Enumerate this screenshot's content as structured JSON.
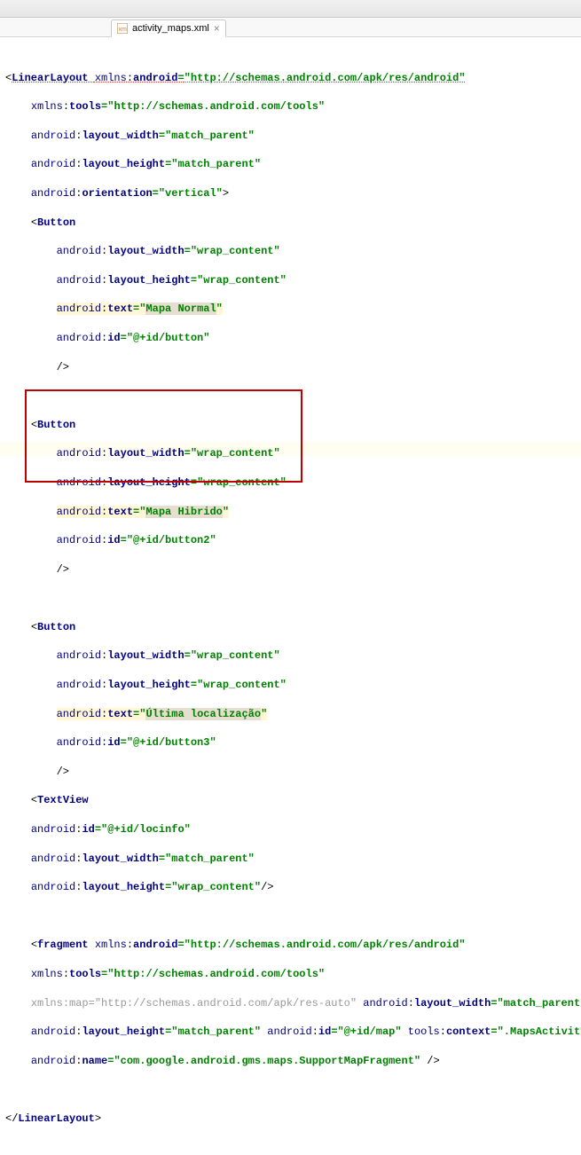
{
  "tab": {
    "filename": "activity_maps.xml",
    "icon": "xml-file-icon"
  },
  "code": {
    "l01a": "<",
    "l01b": "LinearLayout",
    "l01c": " ",
    "l01d": "xmlns",
    "l01e": ":",
    "l01f": "android",
    "l01g": "=",
    "l01h": "\"http://schemas.android.com/apk/res/android\"",
    "l02a": "xmlns",
    "l02b": ":",
    "l02c": "tools",
    "l02d": "=",
    "l02e": "\"http://schemas.android.com/tools\"",
    "l03a": "android",
    "l03b": ":",
    "l03c": "layout_width",
    "l03d": "=",
    "l03e": "\"match_parent\"",
    "l04a": "android",
    "l04b": ":",
    "l04c": "layout_height",
    "l04d": "=",
    "l04e": "\"match_parent\"",
    "l05a": "android",
    "l05b": ":",
    "l05c": "orientation",
    "l05d": "=",
    "l05e": "\"vertical\"",
    "l05f": ">",
    "l06a": "<",
    "l06b": "Button",
    "l07a": "android",
    "l07b": ":",
    "l07c": "layout_width",
    "l07d": "=",
    "l07e": "\"wrap_content\"",
    "l08a": "android",
    "l08b": ":",
    "l08c": "layout_height",
    "l08d": "=",
    "l08e": "\"wrap_content\"",
    "l09a": "android",
    "l09b": ":",
    "l09c": "text",
    "l09d": "=",
    "l09e": "\"",
    "l09f": "Mapa Normal",
    "l09g": "\"",
    "l10a": "android",
    "l10b": ":",
    "l10c": "id",
    "l10d": "=",
    "l10e": "\"@+id/button\"",
    "l11": "/>",
    "l13a": "<",
    "l13b": "Button",
    "l14a": "android",
    "l14b": ":",
    "l14c": "layout_width",
    "l14d": "=",
    "l14e": "\"wrap_content\"",
    "l15a": "android",
    "l15b": ":",
    "l15c": "layout_height",
    "l15d": "=",
    "l15e": "\"wrap_content\"",
    "l16a": "android",
    "l16b": ":",
    "l16c": "text",
    "l16d": "=",
    "l16e": "\"",
    "l16f": "Mapa Hibrido",
    "l16g": "\"",
    "l17a": "android",
    "l17b": ":",
    "l17c": "id",
    "l17d": "=",
    "l17e": "\"@+id/button2\"",
    "l18": "/>",
    "l20a": "<",
    "l20b": "Button",
    "l21a": "android",
    "l21b": ":",
    "l21c": "layout_width",
    "l21d": "=",
    "l21e": "\"wrap_content\"",
    "l22a": "android",
    "l22b": ":",
    "l22c": "layout_height",
    "l22d": "=",
    "l22e": "\"wrap_content\"",
    "l23a": "android",
    "l23b": ":",
    "l23c": "text",
    "l23d": "=",
    "l23e": "\"",
    "l23f": "Última localização",
    "l23g": "\"",
    "l24a": "android",
    "l24b": ":",
    "l24c": "id",
    "l24d": "=",
    "l24e": "\"@+id/button3\"",
    "l25": "/>",
    "l26a": "<",
    "l26b": "TextView",
    "l27a": "android",
    "l27b": ":",
    "l27c": "id",
    "l27d": "=",
    "l27e": "\"@+id/locinfo\"",
    "l28a": "android",
    "l28b": ":",
    "l28c": "layout_width",
    "l28d": "=",
    "l28e": "\"match_parent\"",
    "l29a": "android",
    "l29b": ":",
    "l29c": "layout_height",
    "l29d": "=",
    "l29e": "\"wrap_content\"",
    "l29f": "/>",
    "l31a": "<",
    "l31b": "fragment",
    "l31c": " ",
    "l31d": "xmlns",
    "l31e": ":",
    "l31f": "android",
    "l31g": "=",
    "l31h": "\"http://schemas.android.com/apk/res/android\"",
    "l32a": "xmlns",
    "l32b": ":",
    "l32c": "tools",
    "l32d": "=",
    "l32e": "\"http://schemas.android.com/tools\"",
    "l33": "xmlns:map=\"http://schemas.android.com/apk/res-auto\"",
    "l33b": " ",
    "l33c": "android",
    "l33d": ":",
    "l33e": "layout_width",
    "l33f": "=",
    "l33g": "\"match_parent\"",
    "l34a": "android",
    "l34b": ":",
    "l34c": "layout_height",
    "l34d": "=",
    "l34e": "\"match_parent\"",
    "l34f": " ",
    "l34g": "android",
    "l34h": ":",
    "l34i": "id",
    "l34j": "=",
    "l34k": "\"@+id/map\"",
    "l34l": " ",
    "l34m": "tools",
    "l34n": ":",
    "l34o": "context",
    "l34p": "=",
    "l34q": "\".MapsActivity\"",
    "l35a": "android",
    "l35b": ":",
    "l35c": "name",
    "l35d": "=",
    "l35e": "\"com.google.android.gms.maps.SupportMapFragment\"",
    "l35f": " />",
    "l37a": "</",
    "l37b": "LinearLayout",
    "l37c": ">"
  },
  "colors": {
    "attr": "#000080",
    "string": "#008000",
    "hl": "#fff7d6"
  }
}
